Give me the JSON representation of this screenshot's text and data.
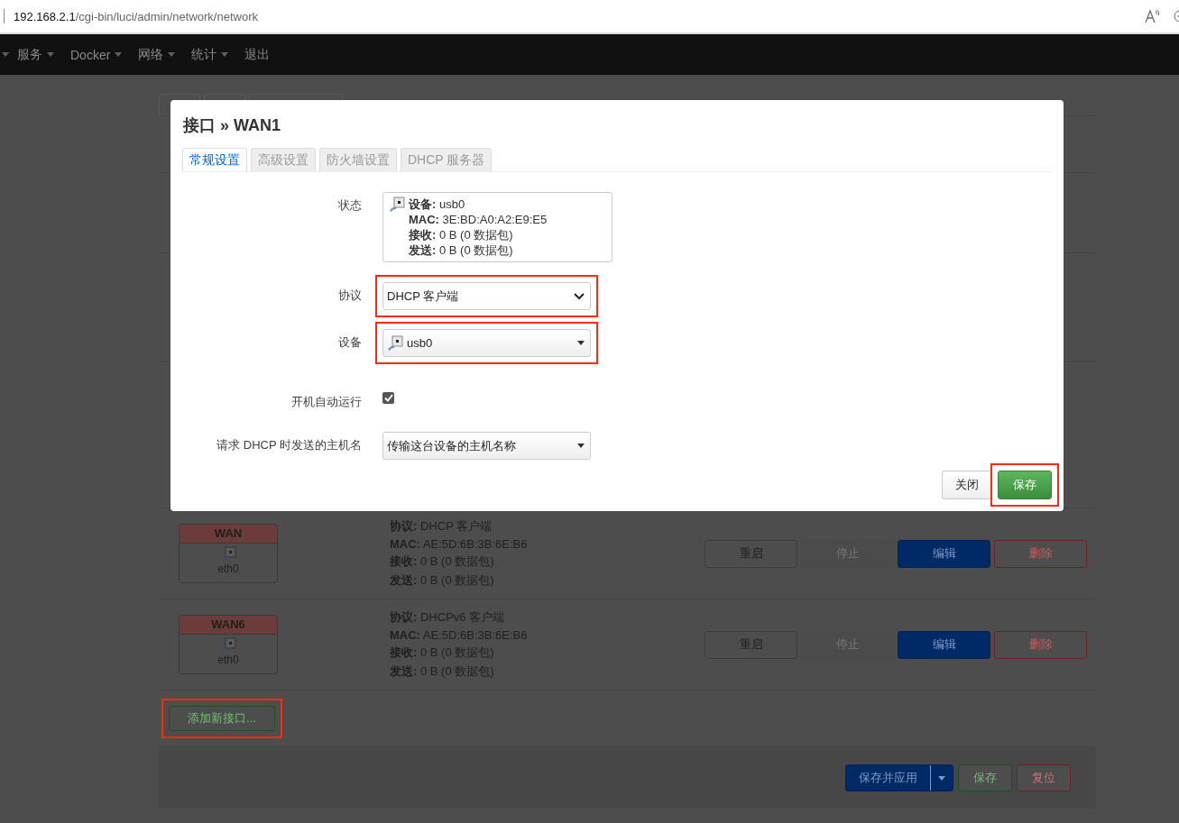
{
  "browser": {
    "url_host": "192.168.2.1",
    "url_path": "/cgi-bin/luci/admin/network/network"
  },
  "nav": {
    "items": [
      {
        "label": "服务",
        "has_menu": true
      },
      {
        "label": "Docker",
        "has_menu": true
      },
      {
        "label": "网络",
        "has_menu": true
      },
      {
        "label": "统计",
        "has_menu": true
      },
      {
        "label": "退出",
        "has_menu": false
      }
    ]
  },
  "interfaces": [
    {
      "name": "WAN",
      "device": "eth0",
      "lines": [
        {
          "label": "协议:",
          "value": "DHCP 客户端"
        },
        {
          "label": "MAC:",
          "value": "AE:5D:6B:3B:6E:B6"
        },
        {
          "label": "接收:",
          "value": "0 B (0 数据包)"
        },
        {
          "label": "发送:",
          "value": "0 B (0 数据包)"
        }
      ],
      "buttons": [
        {
          "label": "重启",
          "kind": "default",
          "disabled": false
        },
        {
          "label": "停止",
          "kind": "default",
          "disabled": true
        },
        {
          "label": "编辑",
          "kind": "primary",
          "disabled": false
        },
        {
          "label": "删除",
          "kind": "danger",
          "disabled": false
        }
      ]
    },
    {
      "name": "WAN6",
      "device": "eth0",
      "lines": [
        {
          "label": "协议:",
          "value": "DHCPv6 客户端"
        },
        {
          "label": "MAC:",
          "value": "AE:5D:6B:3B:6E:B6"
        },
        {
          "label": "接收:",
          "value": "0 B (0 数据包)"
        },
        {
          "label": "发送:",
          "value": "0 B (0 数据包)"
        }
      ],
      "buttons": [
        {
          "label": "重启",
          "kind": "default",
          "disabled": false
        },
        {
          "label": "停止",
          "kind": "default",
          "disabled": true
        },
        {
          "label": "编辑",
          "kind": "primary",
          "disabled": false
        },
        {
          "label": "删除",
          "kind": "danger",
          "disabled": false
        }
      ]
    }
  ],
  "add_button": {
    "label": "添加新接口...",
    "highlighted": true
  },
  "footer_buttons": [
    {
      "label": "保存并应用",
      "kind": "primary",
      "split": true
    },
    {
      "label": "保存",
      "kind": "success"
    },
    {
      "label": "复位",
      "kind": "danger"
    }
  ],
  "modal": {
    "title": "接口 » WAN1",
    "tabs": [
      {
        "label": "常规设置",
        "selected": true
      },
      {
        "label": "高级设置",
        "selected": false
      },
      {
        "label": "防火墙设置",
        "selected": false
      },
      {
        "label": "DHCP 服务器",
        "selected": false
      }
    ],
    "fields": [
      {
        "kind": "status",
        "label": "状态",
        "lines": [
          {
            "label": "设备:",
            "value": "usb0"
          },
          {
            "label": "MAC:",
            "value": "3E:BD:A0:A2:E9:E5"
          },
          {
            "label": "接收:",
            "value": "0 B (0 数据包)"
          },
          {
            "label": "发送:",
            "value": "0 B (0 数据包)"
          }
        ]
      },
      {
        "kind": "select",
        "label": "协议",
        "value": "DHCP 客户端",
        "highlighted": true
      },
      {
        "kind": "device",
        "label": "设备",
        "value": "usb0",
        "highlighted": true
      },
      {
        "kind": "checkbox",
        "label": "开机自动运行",
        "checked": true
      },
      {
        "kind": "dropdown",
        "label": "请求 DHCP 时发送的主机名",
        "value": "传输这台设备的主机名称",
        "highlighted": false
      }
    ],
    "buttons": [
      {
        "label": "关闭",
        "kind": "default",
        "highlighted": false
      },
      {
        "label": "保存",
        "kind": "success",
        "highlighted": true
      }
    ]
  }
}
